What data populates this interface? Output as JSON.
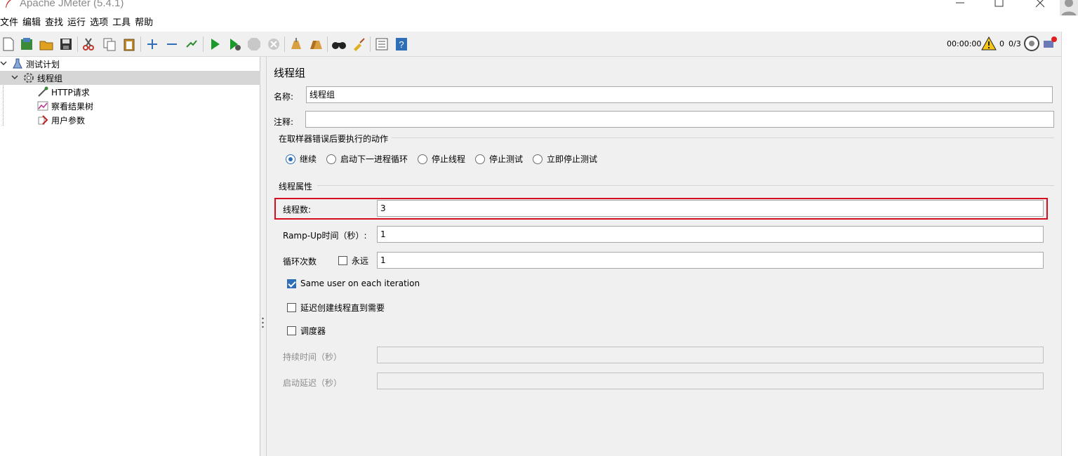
{
  "window": {
    "title": "Apache JMeter (5.4.1)"
  },
  "menu": [
    "文件",
    "编辑",
    "查找",
    "运行",
    "选项",
    "工具",
    "帮助"
  ],
  "status": {
    "timer": "00:00:00",
    "errors": "0",
    "threads": "0/3"
  },
  "tree": {
    "root": "测试计划",
    "thread_group": "线程组",
    "children": [
      "HTTP请求",
      "察看结果树",
      "用户参数"
    ]
  },
  "panel": {
    "title": "线程组",
    "name_label": "名称:",
    "name_value": "线程组",
    "comment_label": "注释:",
    "comment_value": "",
    "error_section": "在取样器错误后要执行的动作",
    "error_options": [
      "继续",
      "启动下一进程循环",
      "停止线程",
      "停止测试",
      "立即停止测试"
    ],
    "error_selected": "继续",
    "props_section": "线程属性",
    "threads_label": "线程数:",
    "threads_value": "3",
    "rampup_label": "Ramp-Up时间（秒）:",
    "rampup_value": "1",
    "loop_label": "循环次数",
    "forever_label": "永远",
    "loop_value": "1",
    "same_user_label": "Same user on each iteration",
    "delay_label": "延迟创建线程直到需要",
    "scheduler_label": "调度器",
    "duration_label": "持续时间（秒）",
    "startup_delay_label": "启动延迟（秒）"
  },
  "colors": {
    "highlight": "#d50f1f",
    "accent": "#2f6fb7"
  }
}
